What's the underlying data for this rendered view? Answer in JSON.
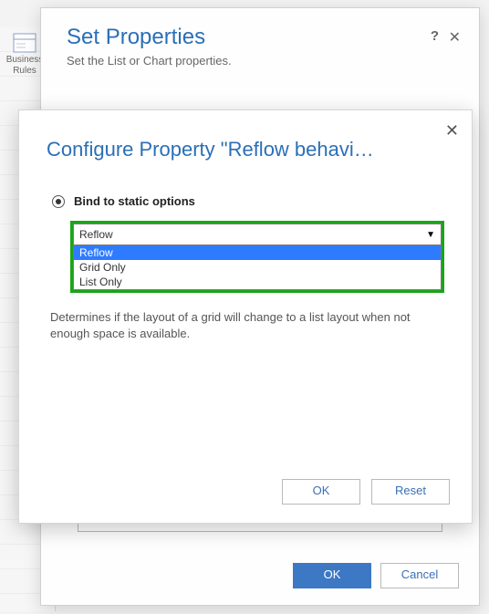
{
  "ribbon": {
    "business_rules": "Business\nRules"
  },
  "outer": {
    "title": "Set Properties",
    "subtitle": "Set the List or Chart properties.",
    "help": "?",
    "close": "✕",
    "ok": "OK",
    "cancel": "Cancel"
  },
  "inner": {
    "title": "Configure Property \"Reflow behavi…",
    "close": "✕",
    "radio_label": "Bind to static options",
    "selected": "Reflow",
    "options": [
      "Reflow",
      "Grid Only",
      "List Only"
    ],
    "description": "Determines if the layout of a grid will change to a list layout when not enough space is available.",
    "ok": "OK",
    "reset": "Reset"
  }
}
